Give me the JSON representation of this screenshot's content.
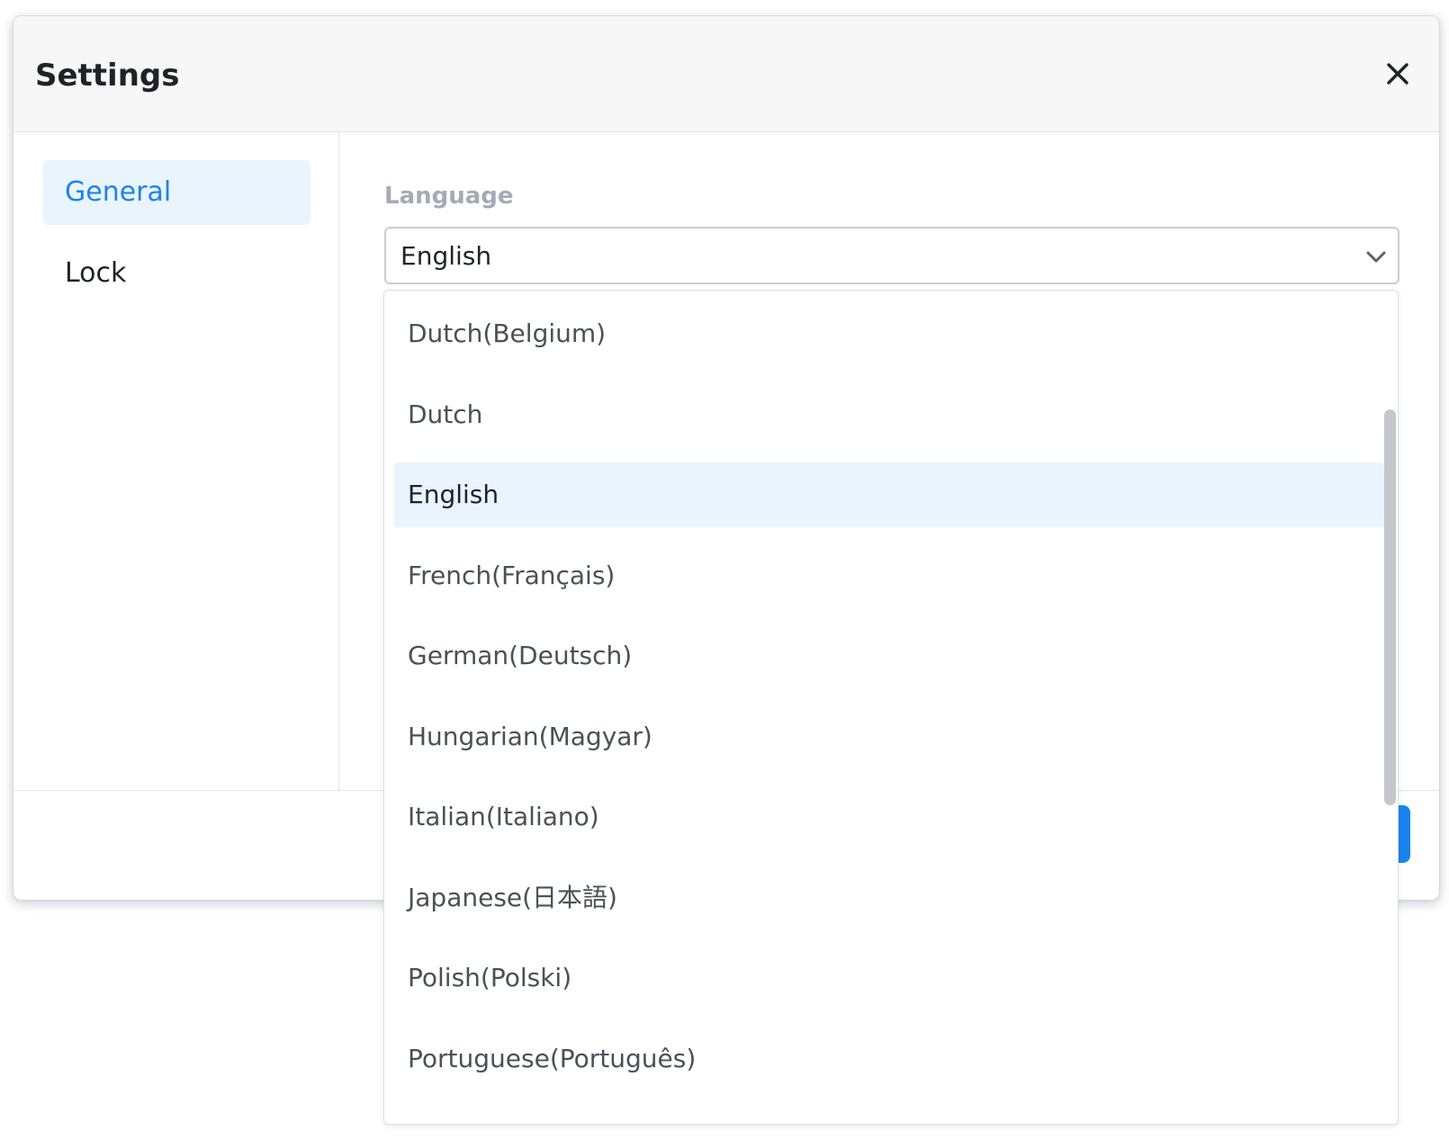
{
  "dialog": {
    "title": "Settings",
    "close_icon": "close-icon"
  },
  "sidebar": {
    "items": [
      {
        "label": "General",
        "active": true
      },
      {
        "label": "Lock",
        "active": false
      }
    ]
  },
  "language": {
    "label": "Language",
    "selected": "English",
    "chevron_icon": "chevron-down-icon",
    "options": [
      "Dutch(Belgium)",
      "Dutch",
      "English",
      "French(Français)",
      "German(Deutsch)",
      "Hungarian(Magyar)",
      "Italian(Italiano)",
      "Japanese(日本語)",
      "Polish(Polski)",
      "Portuguese(Português)"
    ],
    "highlighted_index": 2
  },
  "colors": {
    "accent": "#1a84ee",
    "active_bg": "#e9f4ff",
    "label_gray": "#a4abb5"
  }
}
